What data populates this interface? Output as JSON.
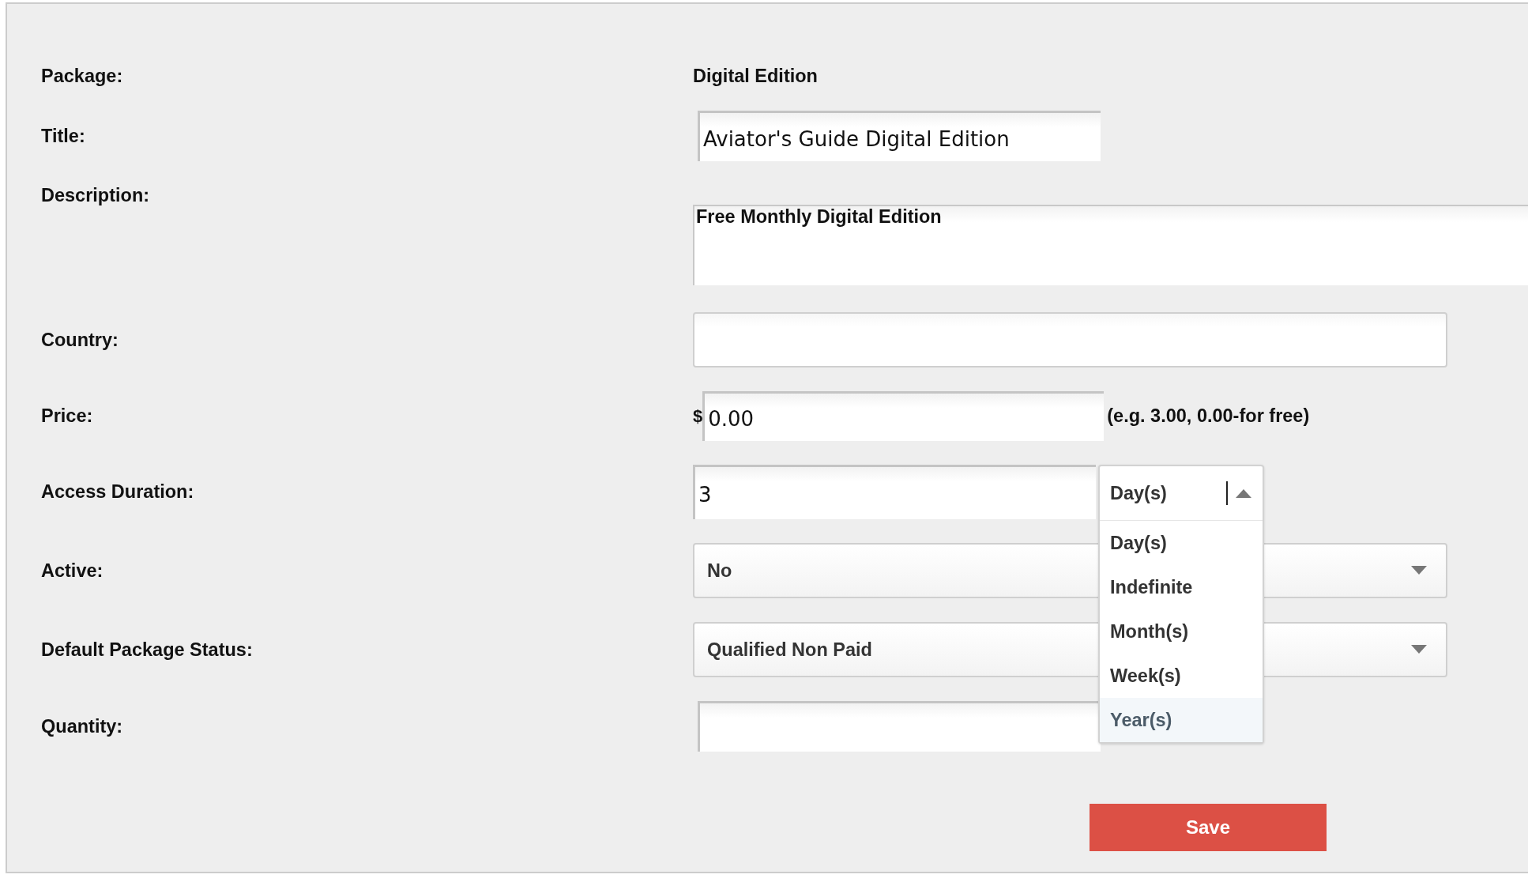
{
  "form": {
    "fields": [
      {
        "kind": "text",
        "label": "Package:",
        "value": "Digital Edition"
      },
      {
        "kind": "input",
        "label": "Title:",
        "value": "Aviator's Guide Digital Edition"
      },
      {
        "kind": "textarea",
        "label": "Description:",
        "value": "Free Monthly Digital Edition"
      },
      {
        "kind": "wide",
        "label": "Country:"
      },
      {
        "kind": "price",
        "label": "Price:",
        "prefix": "$",
        "value": "0.00",
        "hint": "(e.g. 3.00, 0.00-for free)"
      },
      {
        "kind": "duration",
        "label": "Access Duration:",
        "value": "3",
        "unit": {
          "value": "Day(s)",
          "expanded": true,
          "options": [
            {
              "label": "Day(s)",
              "highlighted": false
            },
            {
              "label": "Indefinite",
              "highlighted": false
            },
            {
              "label": "Month(s)",
              "highlighted": false
            },
            {
              "label": "Week(s)",
              "highlighted": false
            },
            {
              "label": "Year(s)",
              "highlighted": true
            }
          ]
        }
      },
      {
        "kind": "select",
        "label": "Active:",
        "value": "No"
      },
      {
        "kind": "select",
        "label": "Default Package Status:",
        "value": "Qualified Non Paid"
      },
      {
        "kind": "input",
        "label": "Quantity:"
      }
    ],
    "save_button": "Save"
  }
}
